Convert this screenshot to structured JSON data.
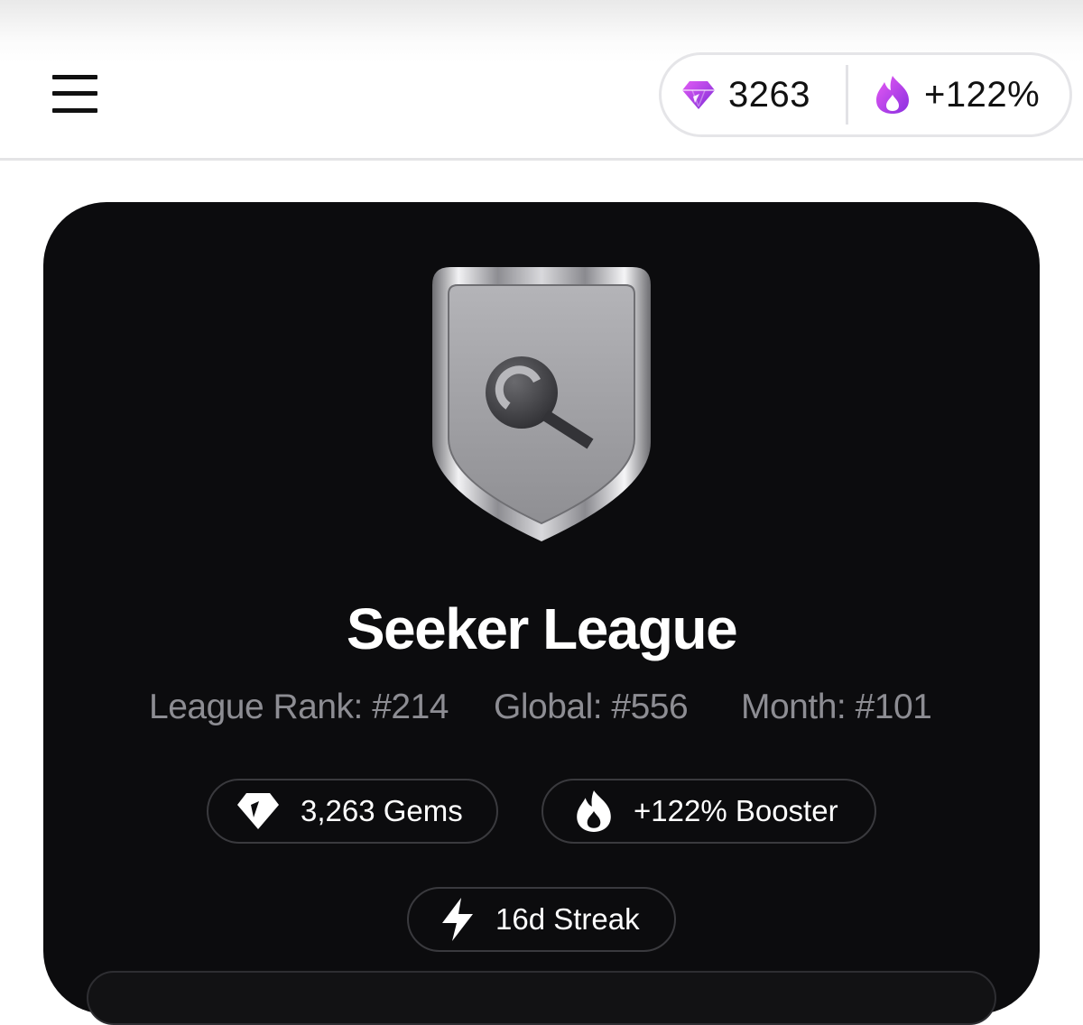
{
  "header": {
    "gems_count": "3263",
    "booster_percent": "+122%"
  },
  "league": {
    "name": "Seeker League",
    "league_rank": "League Rank: #214",
    "global_rank": "Global: #556",
    "month_rank": "Month: #101"
  },
  "chips": {
    "gems": "3,263 Gems",
    "booster": "+122% Booster",
    "streak": "16d Streak"
  },
  "icons": {
    "menu": "hamburger-menu-icon",
    "gem": "gem-icon",
    "flame": "flame-icon",
    "bolt": "lightning-bolt-icon",
    "badge": "shield-badge-icon"
  },
  "colors": {
    "accent_purple": "#b03cf0",
    "card_background": "#0c0c0e",
    "muted_text": "#8d8d93"
  }
}
